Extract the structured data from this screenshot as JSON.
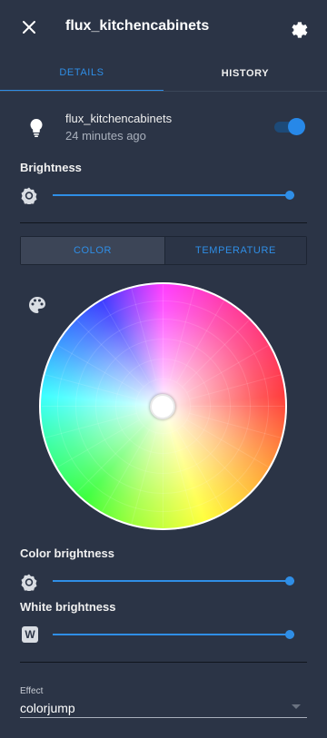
{
  "header": {
    "title": "flux_kitchencabinets",
    "close_icon": "close-icon",
    "settings_icon": "gear-icon"
  },
  "tabs": [
    {
      "label": "DETAILS",
      "active": true
    },
    {
      "label": "HISTORY",
      "active": false
    }
  ],
  "entity": {
    "name": "flux_kitchencabinets",
    "last_changed": "24 minutes ago",
    "icon": "lightbulb-icon",
    "state_on": true
  },
  "brightness": {
    "label": "Brightness",
    "icon": "sun-icon",
    "value_fraction": 0.98
  },
  "mode_toggle": {
    "options": [
      "COLOR",
      "TEMPERATURE"
    ],
    "selected": "COLOR"
  },
  "color_picker": {
    "palette_icon": "palette-icon",
    "selected_color": "#ffffff"
  },
  "color_brightness": {
    "label": "Color brightness",
    "icon": "sun-icon",
    "value_fraction": 0.98
  },
  "white_brightness": {
    "label": "White brightness",
    "icon": "w-icon",
    "icon_letter": "W",
    "value_fraction": 0.98
  },
  "effect": {
    "label": "Effect",
    "value": "colorjump"
  },
  "colors": {
    "background": "#2b3446",
    "accent": "#2f8ee6",
    "text": "#f0f0f0"
  }
}
